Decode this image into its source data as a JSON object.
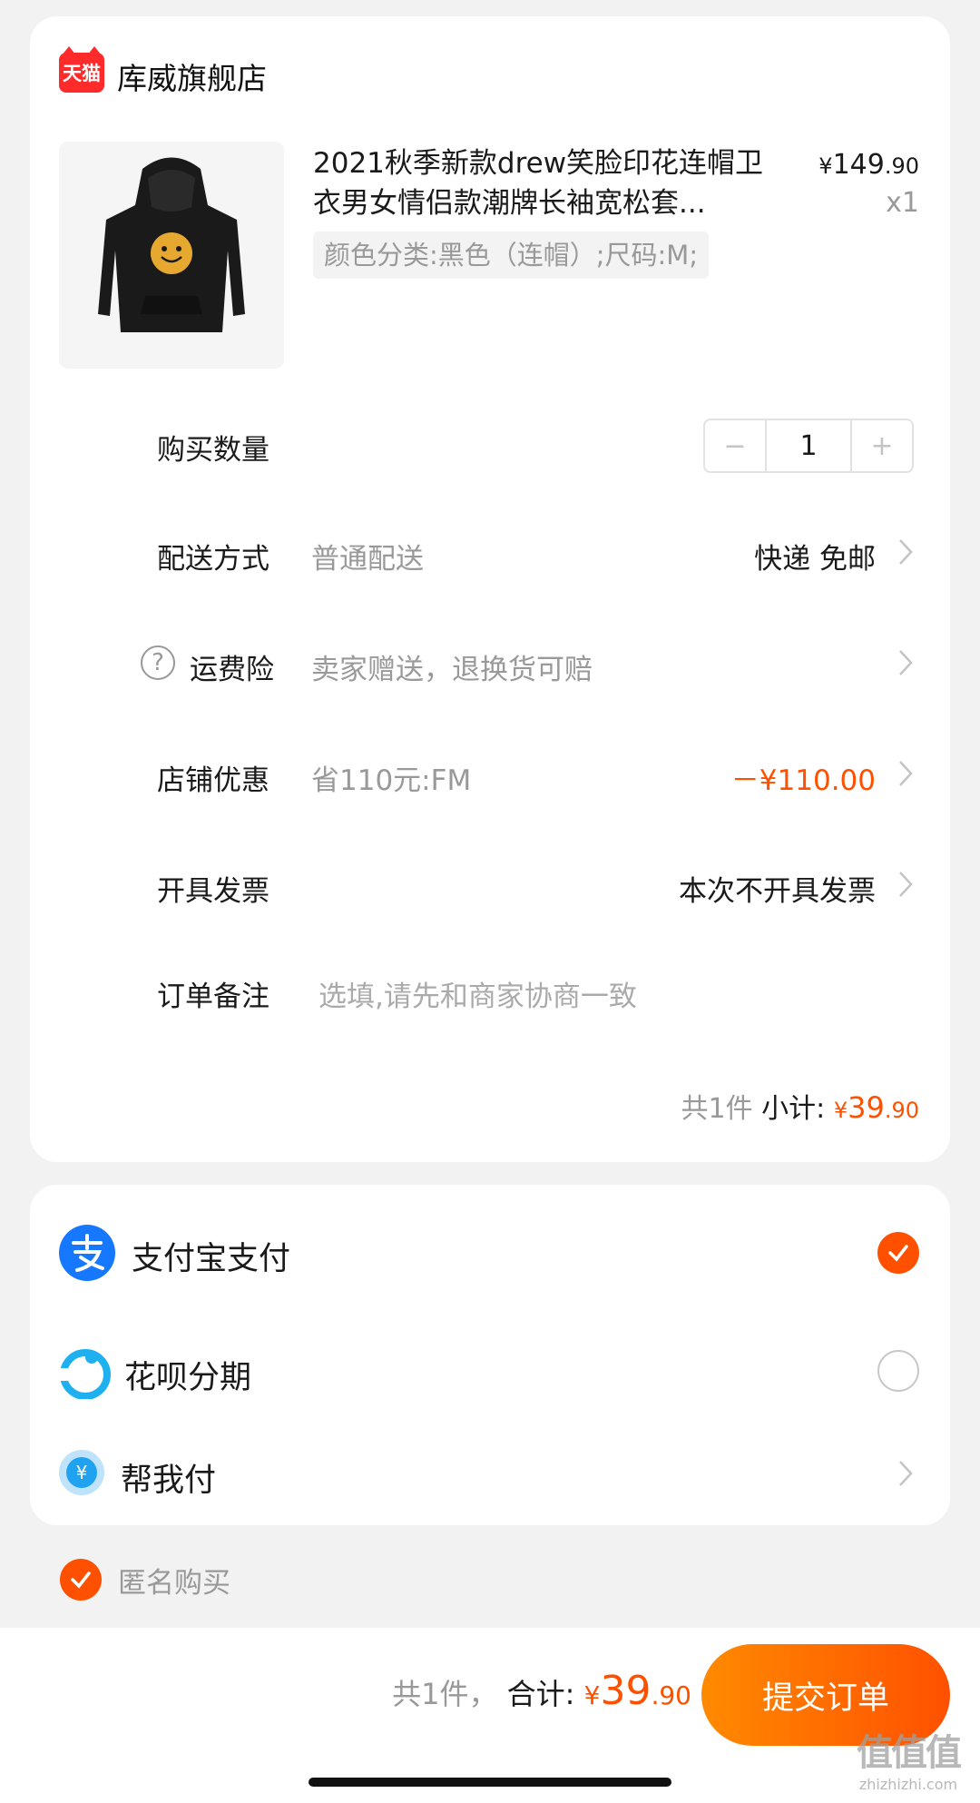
{
  "store": {
    "logo_text": "天猫",
    "name": "库威旗舰店"
  },
  "product": {
    "title": "2021秋季新款drew笑脸印花连帽卫衣男女情侣款潮牌长袖宽松套...",
    "price_currency": "¥",
    "price_main": "149",
    "price_decimal": ".90",
    "quantity_label": "x1",
    "sku": "颜色分类:黑色（连帽）;尺码:M;"
  },
  "rows": {
    "quantity": {
      "label": "购买数量",
      "minus": "−",
      "value": "1",
      "plus": "+"
    },
    "delivery": {
      "label": "配送方式",
      "value": "普通配送",
      "right": "快递 免邮"
    },
    "insurance": {
      "icon_text": "?",
      "label": "运费险",
      "value": "卖家赠送，退换货可赔"
    },
    "discount": {
      "label": "店铺优惠",
      "value": "省110元:FM",
      "right": "－¥110.00"
    },
    "invoice": {
      "label": "开具发票",
      "right": "本次不开具发票"
    },
    "note": {
      "label": "订单备注",
      "placeholder": "选填,请先和商家协商一致"
    }
  },
  "subtotal": {
    "count": "共1件",
    "label": "小计:",
    "currency": "¥",
    "main": "39",
    "decimal": ".90"
  },
  "payment": {
    "alipay": {
      "label": "支付宝支付",
      "selected": true
    },
    "huabei": {
      "label": "花呗分期",
      "selected": false
    },
    "friend": {
      "label": "帮我付"
    }
  },
  "anonymous": {
    "label": "匿名购买",
    "checked": true
  },
  "footer": {
    "count": "共1件，",
    "total_label": "合计:",
    "currency": "¥",
    "main": "39",
    "decimal": ".90",
    "submit": "提交订单"
  },
  "watermark": {
    "logo": "值值值",
    "site": "zhizhizhi.com"
  },
  "colors": {
    "accent": "#ff5000",
    "alipay": "#1677ff",
    "tmall": "#ff2a2a"
  },
  "icons": [
    "tmall-logo-icon",
    "chevron-right-icon",
    "help-circle-icon",
    "check-icon",
    "alipay-icon",
    "huabei-icon",
    "pay-for-me-icon"
  ]
}
